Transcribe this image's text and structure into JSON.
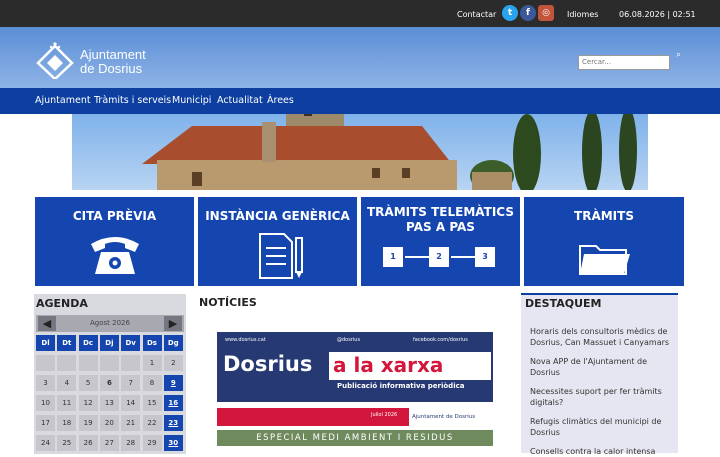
{
  "topbar": {
    "contact": "Contactar",
    "languages": "Idiomes",
    "datetime": "06.08.2026 | 02:51",
    "social": [
      {
        "icon": "twitter-icon",
        "glyph": "t",
        "color": "#2aa3ef"
      },
      {
        "icon": "facebook-icon",
        "glyph": "f",
        "color": "#3b5998"
      },
      {
        "icon": "instagram-icon",
        "glyph": "◎",
        "color": "#c1553b"
      }
    ]
  },
  "header": {
    "logo_line1": "Ajuntament",
    "logo_line2": "de Dosrius",
    "search_placeholder": "Cercar..."
  },
  "nav": {
    "items": [
      "Ajuntament",
      "Tràmits i serveis",
      "Municipi",
      "Actualitat",
      "Àrees"
    ]
  },
  "tiles": {
    "cita": "CITA PRÈVIA",
    "instancia": "INSTÀNCIA GENÈRICA",
    "telematics": "TRÀMITS TELEMÀTICS PAS A PAS",
    "tramits": "TRÀMITS",
    "steps": [
      "1",
      "2",
      "3"
    ]
  },
  "agenda": {
    "title": "AGENDA",
    "month": "Agost 2026",
    "weekdays": [
      "Dl",
      "Dt",
      "Dc",
      "Dj",
      "Dv",
      "Ds",
      "Dg"
    ],
    "weeks": [
      [
        "",
        "",
        "",
        "",
        "",
        "1",
        "2"
      ],
      [
        "3",
        "4",
        "5",
        "6",
        "7",
        "8",
        "9"
      ],
      [
        "10",
        "11",
        "12",
        "13",
        "14",
        "15",
        "16"
      ],
      [
        "17",
        "18",
        "19",
        "20",
        "21",
        "22",
        "23"
      ],
      [
        "24",
        "25",
        "26",
        "27",
        "28",
        "29",
        "30"
      ]
    ],
    "highlighted": [
      "9",
      "16",
      "23",
      "30"
    ],
    "today": "6"
  },
  "news": {
    "title": "NOTÍCIES",
    "img_url_text": "www.dosrius.cat",
    "img_handle": "@dosrius",
    "img_fb": "facebook.com/dosrius",
    "img_headline_a": "Dosrius",
    "img_headline_b": "a la xarxa",
    "img_subtitle": "Publicació informativa periòdica",
    "img_date": "Juliol 2026",
    "img_org": "Ajuntament de Dosrius",
    "img_banner": "ESPECIAL MEDI AMBIENT I RESIDUS"
  },
  "destaquem": {
    "title": "DESTAQUEM",
    "items": [
      "Horaris dels consultoris mèdics de Dosrius, Can Massuet i Canyamars",
      "Nova APP de l'Ajuntament de Dosrius",
      "Necessites suport per fer tràmits digitals?",
      "Refugis climàtics del municipi de Dosrius",
      "Consells contra la calor intensa"
    ]
  }
}
